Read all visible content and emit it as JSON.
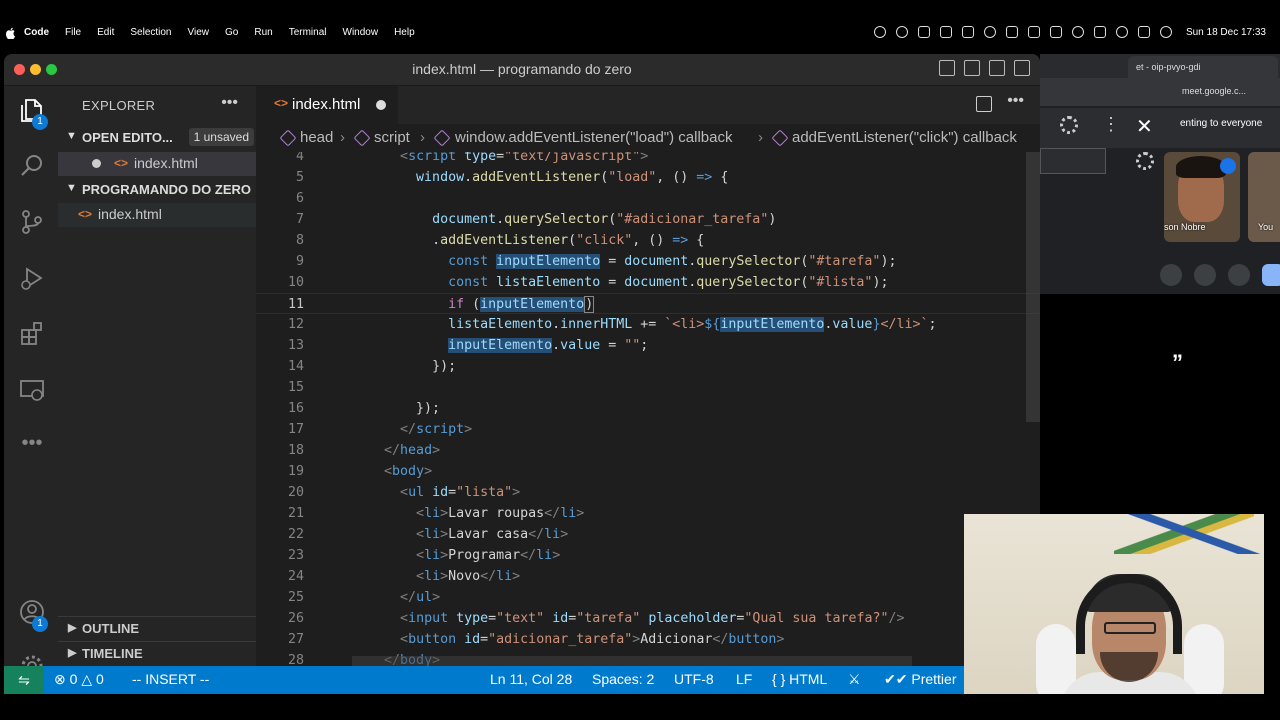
{
  "menubar": {
    "app": "Code",
    "items": [
      "File",
      "Edit",
      "Selection",
      "View",
      "Go",
      "Run",
      "Terminal",
      "Window",
      "Help"
    ],
    "clock": "Sun 18 Dec  17:33"
  },
  "window": {
    "title": "index.html — programando do zero"
  },
  "activity": {
    "explorer_badge": "1",
    "accounts_badge": "1"
  },
  "sidebar": {
    "header": "EXPLORER",
    "open_editors": "OPEN EDITO...",
    "unsaved": "1 unsaved",
    "open_file": "index.html",
    "project": "PROGRAMANDO DO ZERO",
    "project_file": "index.html",
    "outline": "OUTLINE",
    "timeline": "TIMELINE"
  },
  "tab": {
    "name": "index.html"
  },
  "breadcrumb": {
    "items": [
      "head",
      "script",
      "window.addEventListener(\"load\") callback",
      "addEventListener(\"click\") callback"
    ]
  },
  "editor": {
    "line_numbers": [
      "4",
      "5",
      "6",
      "7",
      "8",
      "9",
      "10",
      "11",
      "12",
      "13",
      "14",
      "15",
      "16",
      "17",
      "18",
      "19",
      "20",
      "21",
      "22",
      "23",
      "24",
      "25",
      "26",
      "27",
      "28"
    ],
    "active_line": "11"
  },
  "status": {
    "errors": "0",
    "warnings": "0",
    "mode": "-- INSERT --",
    "position": "Ln 11, Col 28",
    "spaces": "Spaces: 2",
    "encoding": "UTF-8",
    "eol": "LF",
    "language": "HTML",
    "formatter": "Prettier"
  },
  "browser": {
    "tab_title": "et - oip-pvyo-gdi",
    "url": "meet.google.c...",
    "presenting": "enting to everyone",
    "participant": "son Nobre",
    "participant2": "You"
  },
  "overlay_quote": "”",
  "colors": {
    "statusbar": "#007acc",
    "editor_bg": "#1e1e1e",
    "sidebar_bg": "#252526",
    "accent_html_icon": "#e37933"
  }
}
